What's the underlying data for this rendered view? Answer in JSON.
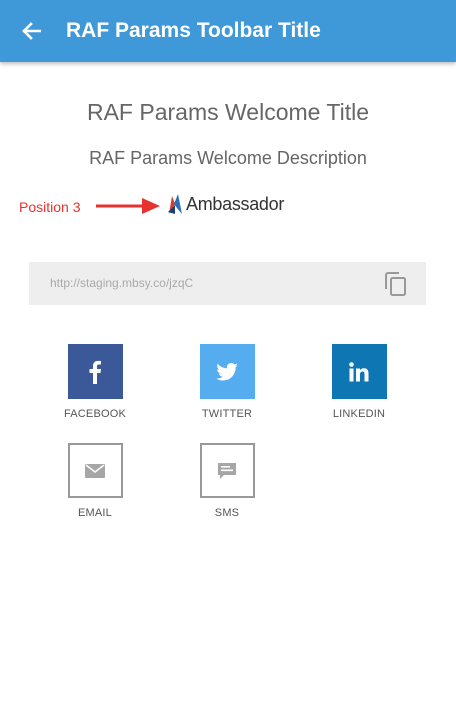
{
  "toolbar": {
    "title": "RAF Params Toolbar Title",
    "back_icon": "arrow-left-icon",
    "color": "#3f98d8"
  },
  "welcome": {
    "title": "RAF Params Welcome Title",
    "description": "RAF Params Welcome Description"
  },
  "annotation": {
    "label": "Position 3",
    "color": "#e8322f"
  },
  "logo": {
    "text": "Ambassador",
    "icon": "ambassador-logo-icon"
  },
  "share_link": {
    "url": "http://staging.mbsy.co/jzqC",
    "copy_icon": "copy-icon"
  },
  "share_options": [
    {
      "label": "FACEBOOK",
      "icon": "facebook-icon",
      "color": "#3b5998"
    },
    {
      "label": "TWITTER",
      "icon": "twitter-icon",
      "color": "#55acee"
    },
    {
      "label": "LINKEDIN",
      "icon": "linkedin-icon",
      "color": "#0e76b2"
    },
    {
      "label": "EMAIL",
      "icon": "mail-icon",
      "color": "#999999"
    },
    {
      "label": "SMS",
      "icon": "message-icon",
      "color": "#999999"
    }
  ]
}
